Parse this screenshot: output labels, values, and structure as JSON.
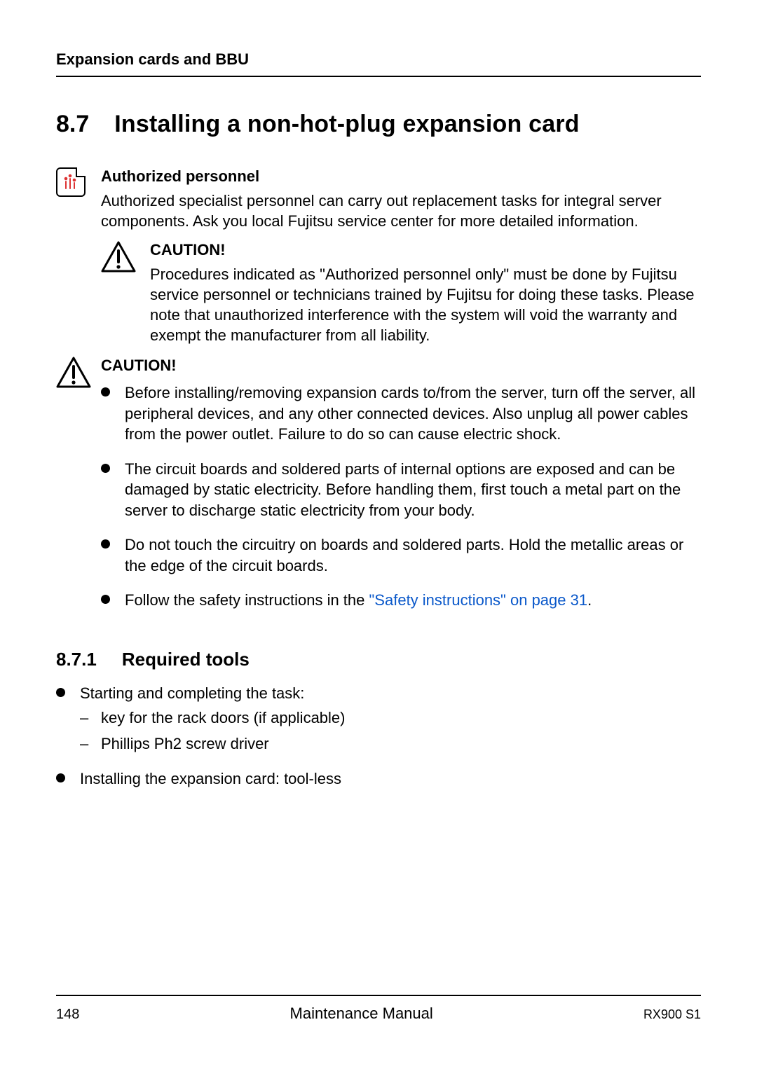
{
  "header": {
    "running": "Expansion cards and BBU"
  },
  "section": {
    "num": "8.7",
    "title": "Installing a non-hot-plug expansion card"
  },
  "auth": {
    "heading": "Authorized personnel",
    "body": "Authorized specialist personnel can carry out replacement tasks for integral server components. Ask you local Fujitsu service center for more detailed information."
  },
  "caution1": {
    "heading": "CAUTION!",
    "body": "Procedures indicated as \"Authorized personnel only\" must be done by Fujitsu service personnel or technicians trained by Fujitsu for doing these tasks. Please note that unauthorized interference with the system will void the warranty and exempt the manufacturer from all liability."
  },
  "caution2": {
    "heading": "CAUTION!",
    "items": [
      "Before installing/removing expansion cards to/from the server, turn off the server, all peripheral devices, and any other connected devices. Also unplug all power cables from the power outlet. Failure to do so can cause electric shock.",
      "The circuit boards and soldered parts of internal options are exposed and can be damaged by static electricity. Before handling them, first touch a metal part on the server to discharge static electricity from your body.",
      "Do not touch the circuitry on boards and soldered parts. Hold the metallic areas or the edge of the circuit boards."
    ],
    "link_lead": "Follow the safety instructions in the ",
    "link_text": "\"Safety instructions\" on page 31",
    "link_tail": "."
  },
  "subsection": {
    "num": "8.7.1",
    "title": "Required tools"
  },
  "tools": {
    "items": [
      {
        "text": "Starting and completing the task:",
        "sub": [
          "key for the rack doors (if applicable)",
          "Phillips Ph2 screw driver"
        ]
      },
      {
        "text": "Installing the expansion card: tool-less"
      }
    ]
  },
  "footer": {
    "page": "148",
    "center": "Maintenance Manual",
    "right": "RX900 S1"
  }
}
